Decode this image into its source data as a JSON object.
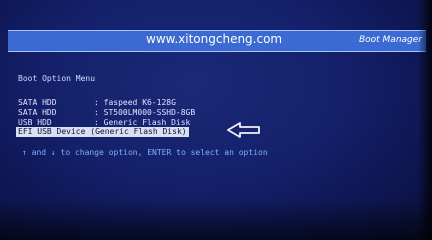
{
  "header": {
    "site": "www.xitongcheng.com",
    "title": "Boot Manager",
    "color": "#3a6ad2"
  },
  "menu": {
    "title": "Boot Option Menu",
    "options": [
      {
        "label": "SATA HDD",
        "sep": ":",
        "value": "faspeed K6-128G"
      },
      {
        "label": "SATA HDD",
        "sep": ":",
        "value": "ST500LM000-SSHD-8GB"
      },
      {
        "label": "USB HDD",
        "sep": ":",
        "value": "Generic Flash Disk"
      },
      {
        "text": "EFI USB Device (Generic Flash Disk)",
        "selected": true
      }
    ]
  },
  "pointer_icon": "arrow-left-icon",
  "hint": "↑ and ↓ to change option, ENTER to select an option"
}
